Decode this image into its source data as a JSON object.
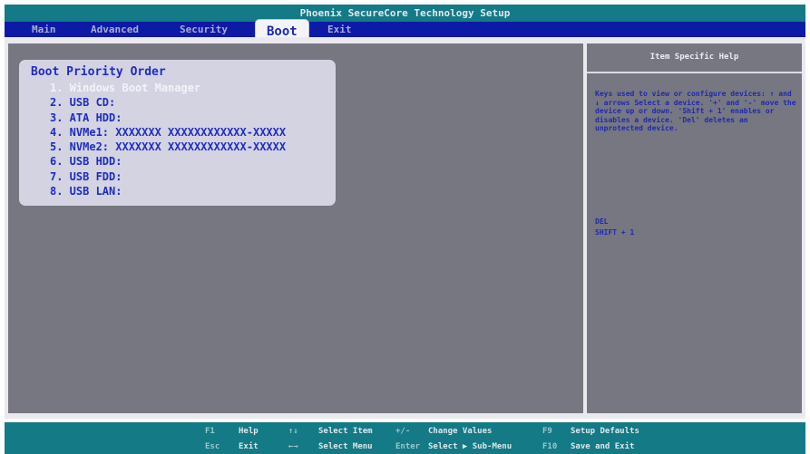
{
  "window": {
    "title": "Phoenix SecureCore Technology Setup"
  },
  "menu": {
    "main": "Main",
    "advanced": "Advanced",
    "security": "Security",
    "boot": "Boot",
    "exit": "Exit",
    "active": "Boot"
  },
  "boot": {
    "heading": "Boot Priority Order",
    "items": [
      "1. Windows Boot Manager",
      "2. USB CD:",
      "3. ATA HDD:",
      "4. NVMe1: XXXXXXX XXXXXXXXXXXX-XXXXX",
      "5. NVMe2: XXXXXXX XXXXXXXXXXXX-XXXXX",
      "6. USB HDD:",
      "7. USB FDD:",
      "8. USB LAN:"
    ],
    "selected_index": 0
  },
  "help": {
    "title": "Item Specific Help",
    "text": "Keys used to view or configure devices: ↑ and ↓ arrows Select a device. '+' and '-' move the device up or down. 'Shift + 1' enables or disables a device. 'Del' deletes an unprotected device.",
    "keys": [
      "DEL",
      "SHIFT + 1"
    ]
  },
  "footer": {
    "f1_key": "F1",
    "f1_label": "Help",
    "esc_key": "Esc",
    "esc_label": "Exit",
    "updown_key": "↑↓",
    "updown_label": "Select Item",
    "leftright_key": "←→",
    "leftright_label": "Select Menu",
    "plusminus_key": "+/-",
    "plusminus_label": "Change Values",
    "enter_key": "Enter",
    "enter_label": "Select ▶ Sub-Menu",
    "f9_key": "F9",
    "f9_label": "Setup Defaults",
    "f10_key": "F10",
    "f10_label": "Save and Exit"
  },
  "colors": {
    "title_bar": "#137a86",
    "menu_bar": "#0d1aa6",
    "panel_bg": "#767781",
    "text_blue": "#1e2cc4"
  }
}
